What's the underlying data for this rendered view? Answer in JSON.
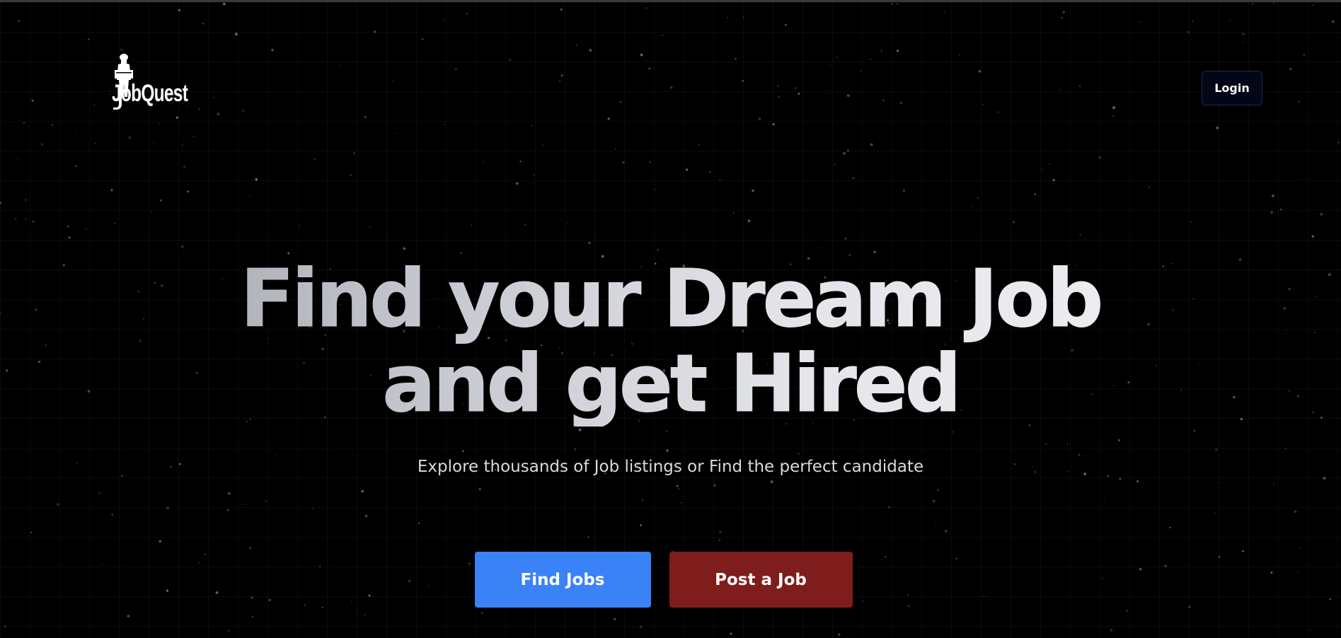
{
  "header": {
    "logo_text": "JobQuest",
    "login_label": "Login"
  },
  "hero": {
    "title_line1": "Find your Dream Job",
    "title_line2": "and get Hired",
    "subtitle": "Explore thousands of Job listings or Find the perfect candidate"
  },
  "actions": {
    "find_jobs_label": "Find Jobs",
    "post_job_label": "Post a Job"
  },
  "colors": {
    "background": "#000000",
    "find_jobs_button": "#3b82f6",
    "post_job_button": "#7f1d1d",
    "login_button": "#020617"
  },
  "icons": {
    "logo": "person-with-briefcase-logo-icon"
  }
}
